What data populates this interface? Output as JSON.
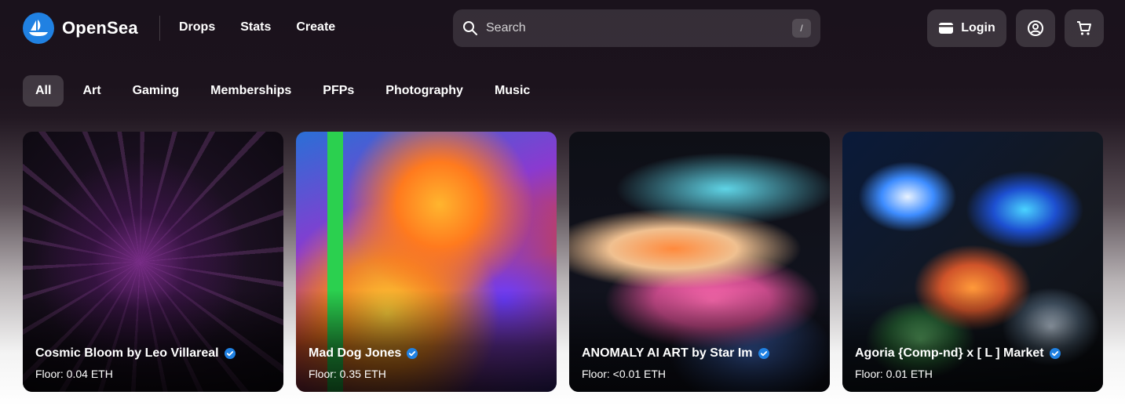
{
  "brand": {
    "name": "OpenSea",
    "accent_color": "#2081e2"
  },
  "nav": {
    "items": [
      "Drops",
      "Stats",
      "Create"
    ]
  },
  "search": {
    "placeholder": "Search",
    "shortcut": "/"
  },
  "header_actions": {
    "login_label": "Login",
    "profile_icon": "user-circle-icon",
    "cart_icon": "cart-icon"
  },
  "categories": {
    "items": [
      "All",
      "Art",
      "Gaming",
      "Memberships",
      "PFPs",
      "Photography",
      "Music"
    ],
    "selected": "All"
  },
  "collections": [
    {
      "title": "Cosmic Bloom by Leo Villareal",
      "floor": "Floor: 0.04 ETH",
      "verified": true
    },
    {
      "title": "Mad Dog Jones",
      "floor": "Floor: 0.35 ETH",
      "verified": true
    },
    {
      "title": "ANOMALY AI ART by Star Im",
      "floor": "Floor: <0.01 ETH",
      "verified": true
    },
    {
      "title": "Agoria {Comp-nd} x [ L ] Market",
      "floor": "Floor: 0.01 ETH",
      "verified": true
    }
  ]
}
